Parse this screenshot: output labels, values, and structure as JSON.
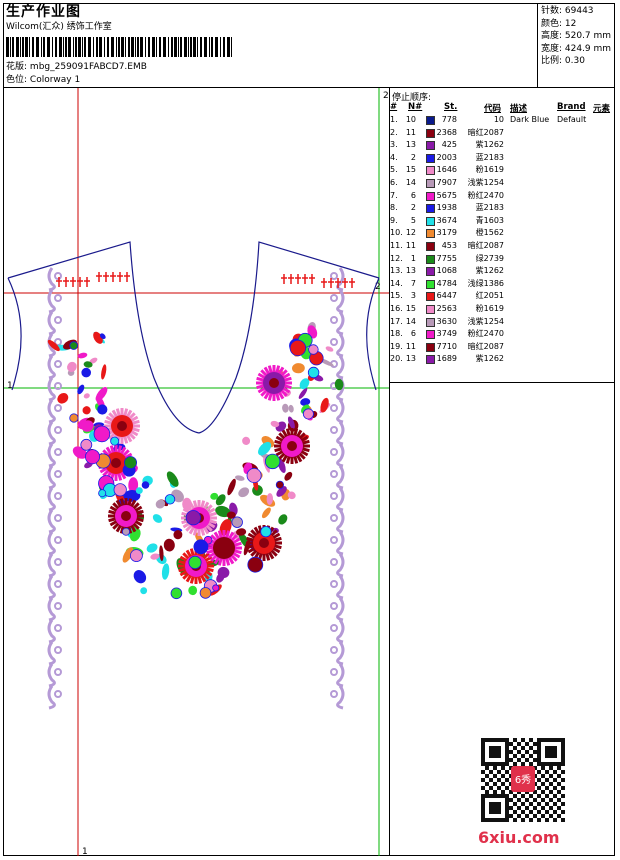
{
  "header": {
    "title": "生产作业图",
    "subtitle": "Wilcom(汇众) 绣饰工作室",
    "design_label": "花版:",
    "design_name": "mbg_259091FABCD7.EMB",
    "colorway_label": "色位:",
    "colorway": "Colorway 1"
  },
  "stats": {
    "stitches": "针数: 69443",
    "colors": "颜色: 12",
    "height": "高度: 520.7 mm",
    "width": "宽度: 424.9 mm",
    "scale": "比例: 0.30"
  },
  "artwork": {
    "guide_marks": [
      "1",
      "2",
      "1",
      "2"
    ],
    "colors": {
      "outline": "#1a1a8c",
      "red_guide": "#cc0000",
      "green_guide": "#00b400",
      "vine": "#b59ad6"
    }
  },
  "stop_sequence": {
    "title": "停止顺序:",
    "headers": [
      "#",
      "N#",
      "St.",
      "代码",
      "描述",
      "Brand",
      "元素"
    ],
    "rows": [
      {
        "idx": "1.",
        "n": "10",
        "st": "778",
        "swatch": "#0a1a8c",
        "code": "10",
        "desc": "Dark Blue",
        "brand": "Default"
      },
      {
        "idx": "2.",
        "n": "11",
        "st": "2368",
        "swatch": "#8a0010",
        "code": "暗红2087",
        "desc": "",
        "brand": ""
      },
      {
        "idx": "3.",
        "n": "13",
        "st": "425",
        "swatch": "#8a1aa8",
        "code": "紫1262",
        "desc": "",
        "brand": ""
      },
      {
        "idx": "4.",
        "n": "2",
        "st": "2003",
        "swatch": "#1a1ae6",
        "code": "蓝2183",
        "desc": "",
        "brand": ""
      },
      {
        "idx": "5.",
        "n": "15",
        "st": "1646",
        "swatch": "#f08ac8",
        "code": "粉1619",
        "desc": "",
        "brand": ""
      },
      {
        "idx": "6.",
        "n": "14",
        "st": "7907",
        "swatch": "#b89ab8",
        "code": "浅紫1254",
        "desc": "",
        "brand": ""
      },
      {
        "idx": "7.",
        "n": "6",
        "st": "5675",
        "swatch": "#f01ac8",
        "code": "粉红2470",
        "desc": "",
        "brand": ""
      },
      {
        "idx": "8.",
        "n": "2",
        "st": "1938",
        "swatch": "#1a1ae6",
        "code": "蓝2183",
        "desc": "",
        "brand": ""
      },
      {
        "idx": "9.",
        "n": "5",
        "st": "3674",
        "swatch": "#20e0e8",
        "code": "青1603",
        "desc": "",
        "brand": ""
      },
      {
        "idx": "10.",
        "n": "12",
        "st": "3179",
        "swatch": "#f08a30",
        "code": "橙1562",
        "desc": "",
        "brand": ""
      },
      {
        "idx": "11.",
        "n": "11",
        "st": "453",
        "swatch": "#8a0010",
        "code": "暗红2087",
        "desc": "",
        "brand": ""
      },
      {
        "idx": "12.",
        "n": "1",
        "st": "7755",
        "swatch": "#1a8a1a",
        "code": "绿2739",
        "desc": "",
        "brand": ""
      },
      {
        "idx": "13.",
        "n": "13",
        "st": "1068",
        "swatch": "#8a1aa8",
        "code": "紫1262",
        "desc": "",
        "brand": ""
      },
      {
        "idx": "14.",
        "n": "7",
        "st": "4784",
        "swatch": "#30e030",
        "code": "浅绿1386",
        "desc": "",
        "brand": ""
      },
      {
        "idx": "15.",
        "n": "3",
        "st": "6447",
        "swatch": "#e81818",
        "code": "红2051",
        "desc": "",
        "brand": ""
      },
      {
        "idx": "16.",
        "n": "15",
        "st": "2563",
        "swatch": "#f08ac8",
        "code": "粉1619",
        "desc": "",
        "brand": ""
      },
      {
        "idx": "17.",
        "n": "14",
        "st": "3630",
        "swatch": "#b89ab8",
        "code": "浅紫1254",
        "desc": "",
        "brand": ""
      },
      {
        "idx": "18.",
        "n": "6",
        "st": "3749",
        "swatch": "#f01ac8",
        "code": "粉红2470",
        "desc": "",
        "brand": ""
      },
      {
        "idx": "19.",
        "n": "11",
        "st": "7710",
        "swatch": "#8a0010",
        "code": "暗红2087",
        "desc": "",
        "brand": ""
      },
      {
        "idx": "20.",
        "n": "13",
        "st": "1689",
        "swatch": "#8a1aa8",
        "code": "紫1262",
        "desc": "",
        "brand": ""
      }
    ]
  },
  "watermark": {
    "text": "6xiu.com",
    "color": "#e0314b",
    "qr_seal_text": "6秀"
  }
}
